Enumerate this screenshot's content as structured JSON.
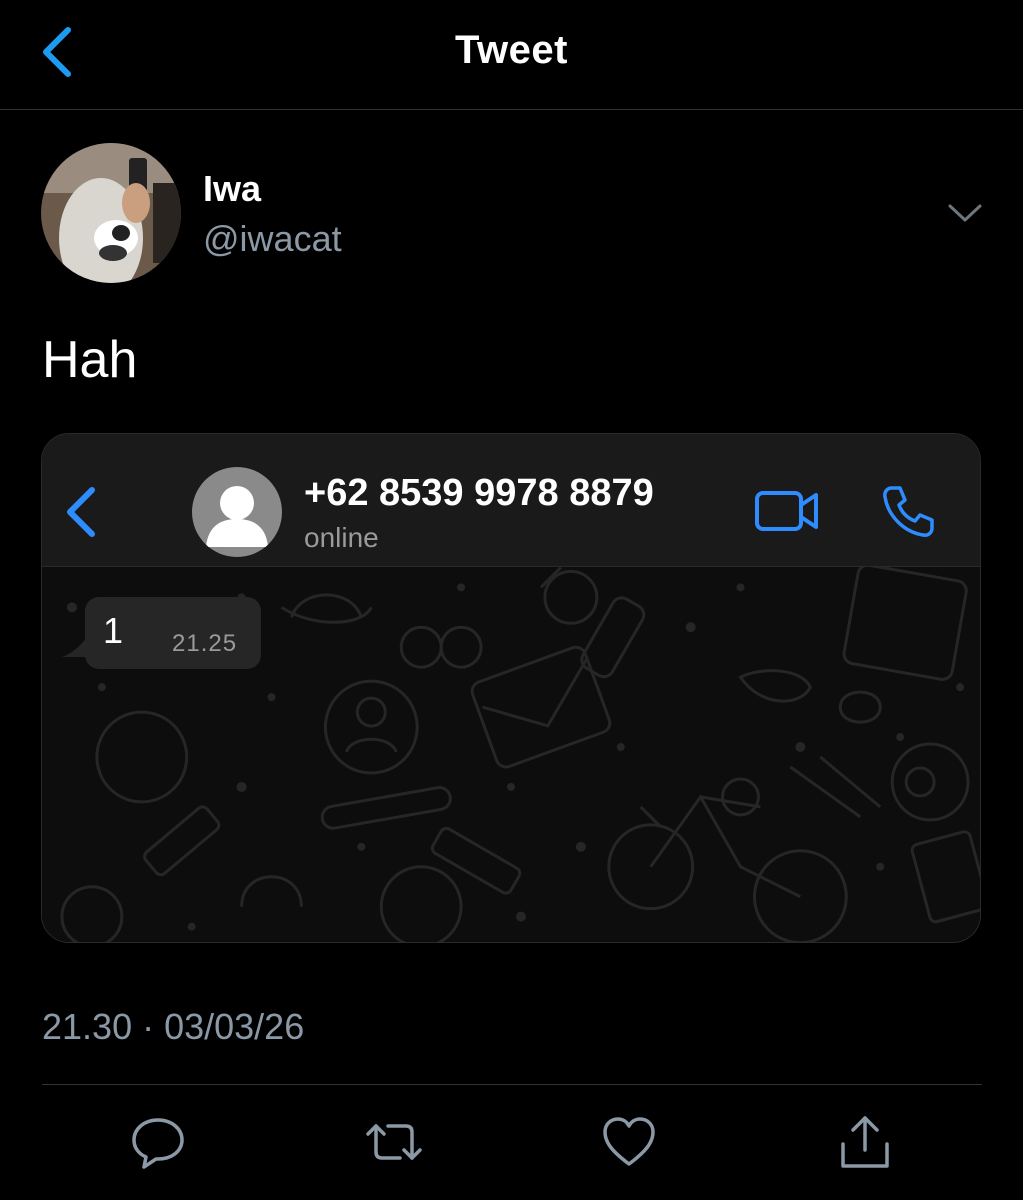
{
  "header": {
    "title": "Tweet"
  },
  "author": {
    "display_name": "Iwa",
    "handle": "@iwacat"
  },
  "tweet": {
    "text": "Hah",
    "timestamp": "21.30 · 03/03/26"
  },
  "embedded_screenshot": {
    "contact": "+62 8539 9978 8879",
    "status": "online",
    "message": {
      "text": "1",
      "time": "21.25"
    }
  },
  "icons": {
    "back": "chevron-left-icon",
    "more": "chevron-down-icon",
    "video": "video-camera-icon",
    "call": "phone-icon",
    "reply": "reply-bubble-icon",
    "retweet": "retweet-icon",
    "like": "heart-icon",
    "share": "share-icon"
  },
  "colors": {
    "accent": "#1d9bf0",
    "wa_accent": "#2f8cff",
    "muted": "#8b98a5"
  }
}
